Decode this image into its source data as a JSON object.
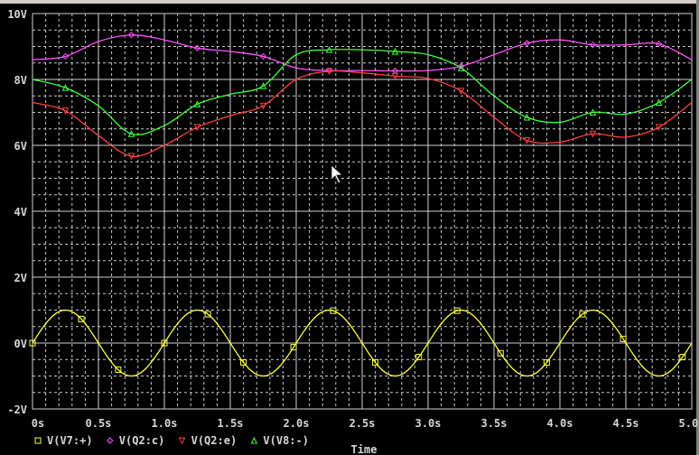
{
  "chart_data": {
    "type": "line",
    "title": "",
    "xlabel": "Time",
    "ylabel": "",
    "xlim": [
      0,
      5.0
    ],
    "ylim": [
      -2,
      10
    ],
    "grid": true,
    "legend_placement": "bottom",
    "x_ticks": [
      "0s",
      "0.5s",
      "1.0s",
      "1.5s",
      "2.0s",
      "2.5s",
      "3.0s",
      "3.5s",
      "4.0s",
      "4.5s",
      "5.0s"
    ],
    "y_ticks": [
      "-2V",
      "0V",
      "2V",
      "4V",
      "6V",
      "8V",
      "10V"
    ],
    "x_tick_values": [
      0,
      0.5,
      1.0,
      1.5,
      2.0,
      2.5,
      3.0,
      3.5,
      4.0,
      4.5,
      5.0
    ],
    "y_tick_values": [
      -2,
      0,
      2,
      4,
      6,
      8,
      10
    ],
    "x": [
      0,
      0.25,
      0.5,
      0.75,
      1.0,
      1.25,
      1.5,
      1.75,
      2.0,
      2.25,
      2.5,
      2.75,
      3.0,
      3.25,
      3.5,
      3.75,
      4.0,
      4.25,
      4.5,
      4.75,
      5.0
    ],
    "series": [
      {
        "name": "V(V7:+)",
        "color": "#ffff40",
        "marker": "square",
        "function": "sine",
        "amplitude": 1.0,
        "frequency_hz": 1.0,
        "offset": 0.0
      },
      {
        "name": "V(Q2:c)",
        "color": "#ff50ff",
        "marker": "diamond",
        "values": [
          8.6,
          8.7,
          9.15,
          9.35,
          9.2,
          8.95,
          8.85,
          8.7,
          8.35,
          8.27,
          8.27,
          8.26,
          8.27,
          8.4,
          8.75,
          9.1,
          9.2,
          9.05,
          9.05,
          9.08,
          8.6
        ]
      },
      {
        "name": "V(Q2:e)",
        "color": "#ff4040",
        "marker": "triangle-down",
        "values": [
          7.3,
          7.05,
          6.3,
          5.67,
          6.0,
          6.55,
          6.9,
          7.2,
          8.0,
          8.25,
          8.2,
          8.1,
          8.03,
          7.65,
          6.85,
          6.15,
          6.1,
          6.35,
          6.25,
          6.55,
          7.3
        ]
      },
      {
        "name": "V(V8:-)",
        "color": "#40ff40",
        "marker": "triangle-up",
        "values": [
          8.0,
          7.75,
          7.2,
          6.35,
          6.6,
          7.25,
          7.55,
          7.8,
          8.75,
          8.9,
          8.9,
          8.85,
          8.75,
          8.35,
          7.5,
          6.85,
          6.7,
          7.0,
          6.95,
          7.3,
          8.0
        ]
      }
    ]
  }
}
